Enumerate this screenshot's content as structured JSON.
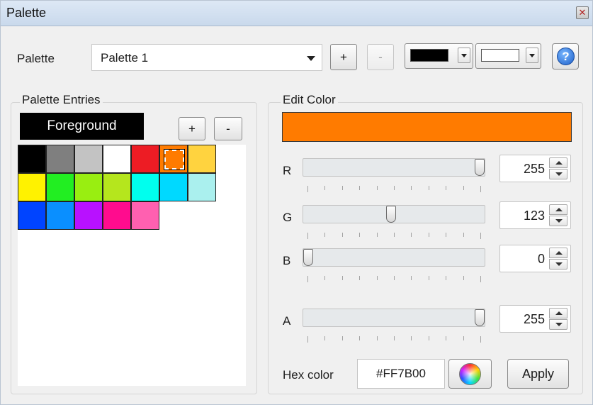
{
  "window": {
    "title": "Palette",
    "close_glyph": "✕"
  },
  "toolbar": {
    "palette_label": "Palette",
    "palette_selected": "Palette 1",
    "add_label": "+",
    "remove_label": "-",
    "foreground_swatch_color": "#000000",
    "background_swatch_color": "#ffffff",
    "help_glyph": "?"
  },
  "entries": {
    "group_label": "Palette Entries",
    "current_target": "Foreground",
    "add_label": "+",
    "remove_label": "-",
    "selected_index": 5,
    "colors": [
      "#000000",
      "#7f7f7f",
      "#c3c3c3",
      "#ffffff",
      "#ed1c24",
      "#ff7b00",
      "#ffd33f",
      "#fff200",
      "#22ee22",
      "#99ee11",
      "#b5e61d",
      "#00ffee",
      "#00d9ff",
      "#aaf0ee",
      "#0044ff",
      "#0a8fff",
      "#b811ff",
      "#ff0c8e",
      "#ff60b0"
    ]
  },
  "edit": {
    "group_label": "Edit Color",
    "preview_color": "#FF7B00",
    "channels": [
      {
        "label": "R",
        "value": "255",
        "fraction": 1.0
      },
      {
        "label": "G",
        "value": "123",
        "fraction": 0.482
      },
      {
        "label": "B",
        "value": "0",
        "fraction": 0.0
      },
      {
        "label": "A",
        "value": "255",
        "fraction": 1.0
      }
    ],
    "hex_label": "Hex color",
    "hex_value": "#FF7B00",
    "apply_label": "Apply"
  },
  "icons": {
    "close": "close-icon",
    "dropdown": "chevron-down-icon",
    "help": "help-icon",
    "color_wheel": "color-wheel-icon"
  }
}
